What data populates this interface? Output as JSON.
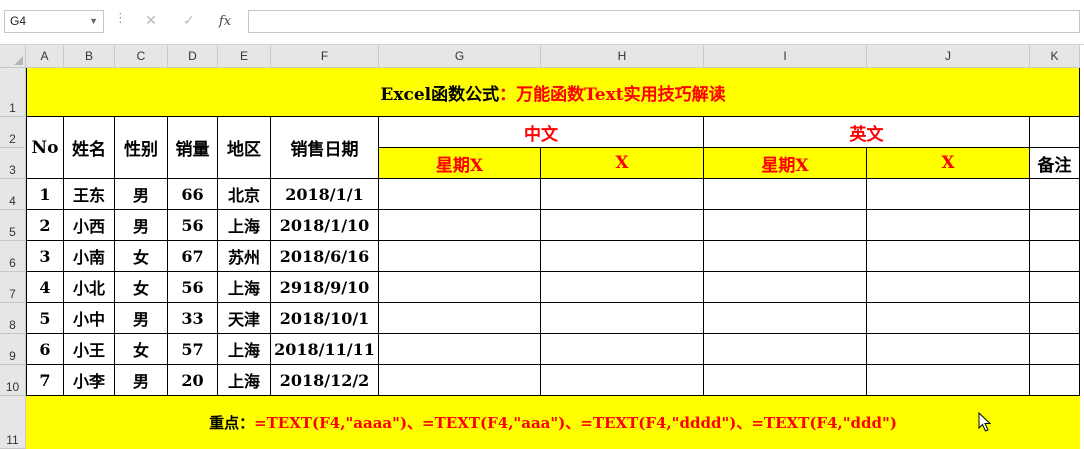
{
  "formula_bar": {
    "name_box": "G4",
    "cancel_glyph": "✕",
    "enter_glyph": "✓",
    "fx_label": "fx",
    "formula_value": ""
  },
  "columns": [
    "A",
    "B",
    "C",
    "D",
    "E",
    "F",
    "G",
    "H",
    "I",
    "J",
    "K"
  ],
  "rows": [
    "1",
    "2",
    "3",
    "4",
    "5",
    "6",
    "7",
    "8",
    "9",
    "10",
    "11"
  ],
  "sheet": {
    "title_black": "Excel函数公式",
    "title_red": "：万能函数Text实用技巧解读",
    "headers": {
      "no": "No",
      "name": "姓名",
      "gender": "性别",
      "sales": "销量",
      "region": "地区",
      "date": "销售日期",
      "chinese": "中文",
      "english": "英文",
      "weekday_x": "星期X",
      "x": "X",
      "weekday_x2": "星期X",
      "x2": "X",
      "remark": "备注"
    },
    "data": [
      {
        "no": "1",
        "name": "王东",
        "gender": "男",
        "sales": "66",
        "region": "北京",
        "date": "2018/1/1"
      },
      {
        "no": "2",
        "name": "小西",
        "gender": "男",
        "sales": "56",
        "region": "上海",
        "date": "2018/1/10"
      },
      {
        "no": "3",
        "name": "小南",
        "gender": "女",
        "sales": "67",
        "region": "苏州",
        "date": "2018/6/16"
      },
      {
        "no": "4",
        "name": "小北",
        "gender": "女",
        "sales": "56",
        "region": "上海",
        "date": "2918/9/10"
      },
      {
        "no": "5",
        "name": "小中",
        "gender": "男",
        "sales": "33",
        "region": "天津",
        "date": "2018/10/1"
      },
      {
        "no": "6",
        "name": "小王",
        "gender": "女",
        "sales": "57",
        "region": "上海",
        "date": "2018/11/11"
      },
      {
        "no": "7",
        "name": "小李",
        "gender": "男",
        "sales": "20",
        "region": "上海",
        "date": "2018/12/2"
      }
    ],
    "note_label": "重点：",
    "note_formula": "=TEXT(F4,\"aaaa\")、=TEXT(F4,\"aaa\")、=TEXT(F4,\"dddd\")、=TEXT(F4,\"ddd\")"
  },
  "colors": {
    "highlight": "#ffff00",
    "accent_red": "#ff0000",
    "header_gray": "#e6e6e6"
  }
}
